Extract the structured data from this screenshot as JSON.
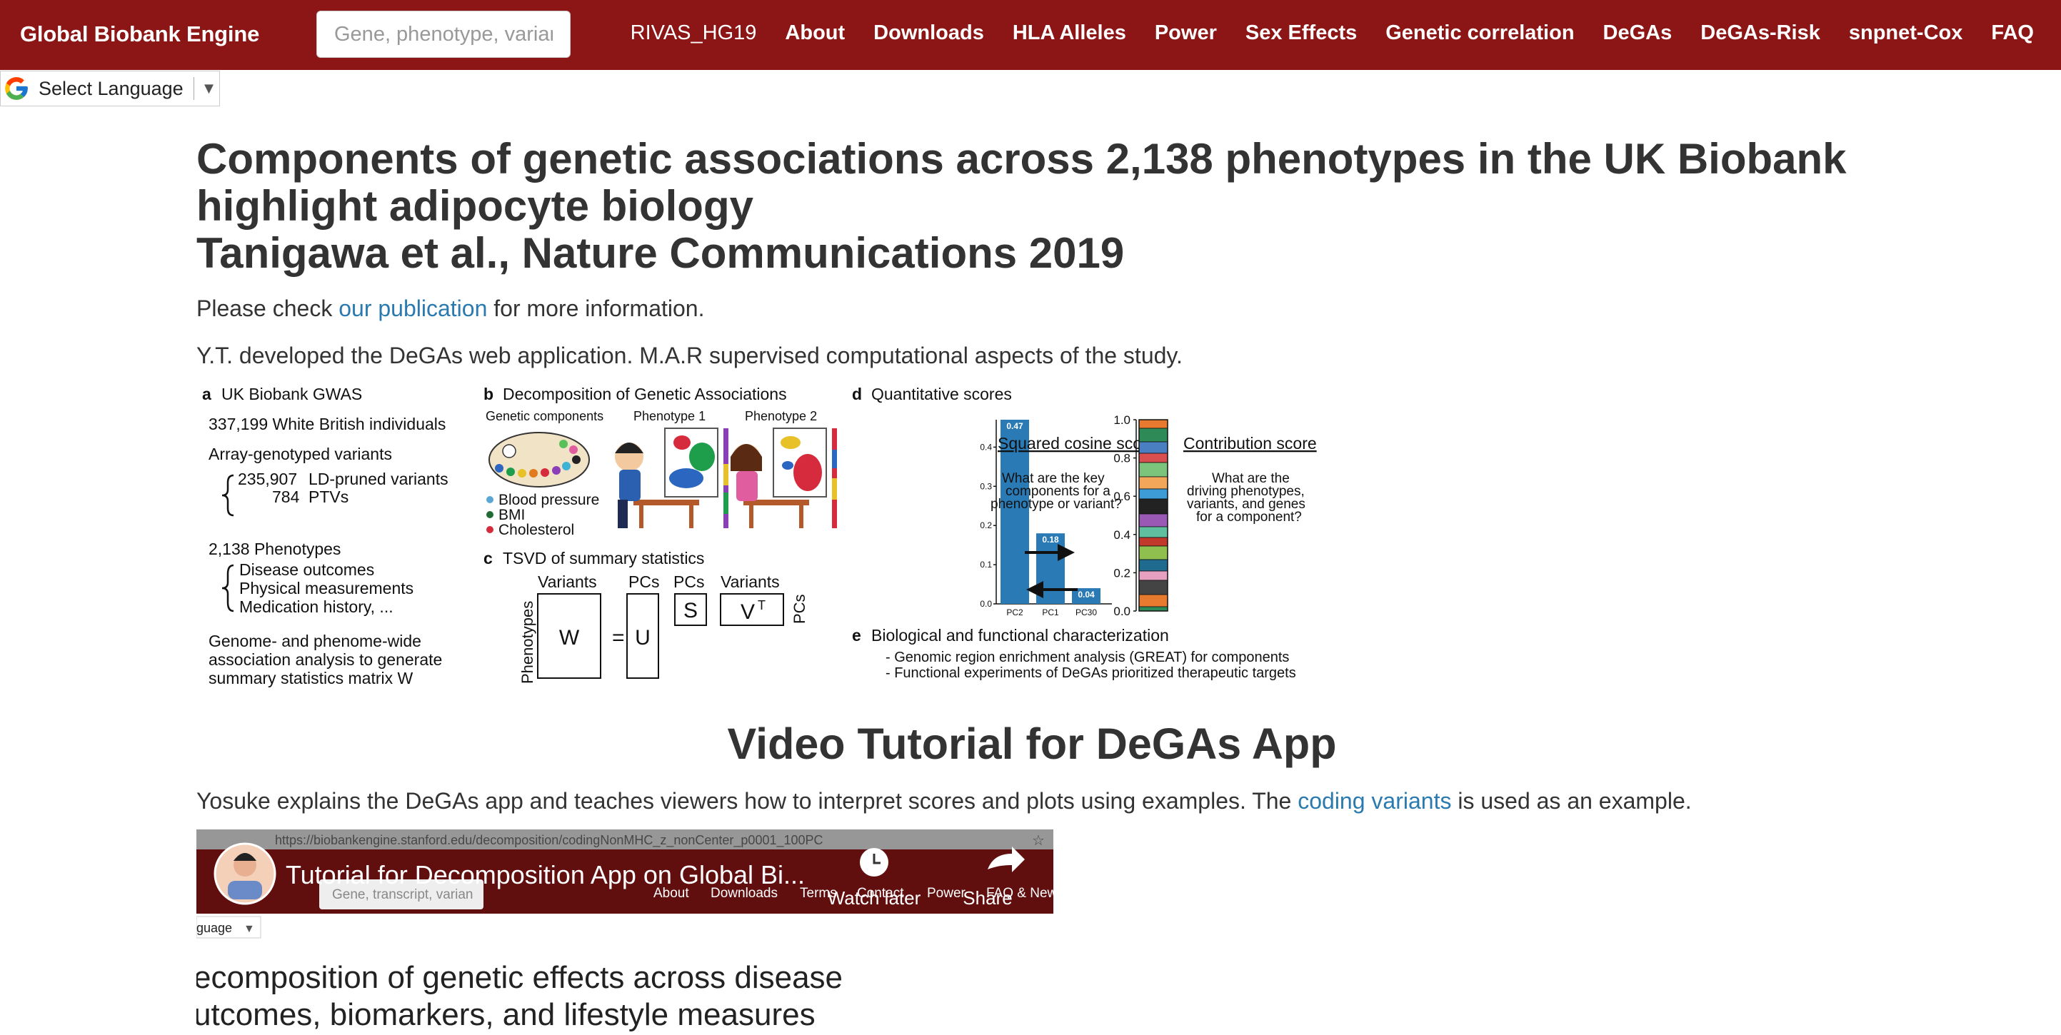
{
  "navbar": {
    "brand": "Global Biobank Engine",
    "search_placeholder": "Gene, phenotype, varian",
    "links": [
      "RIVAS_HG19",
      "About",
      "Downloads",
      "HLA Alleles",
      "Power",
      "Sex Effects",
      "Genetic correlation",
      "DeGAs",
      "DeGAs-Risk",
      "snpnet-Cox",
      "FAQ"
    ],
    "brand_color": "#8c1515"
  },
  "language": {
    "label": "Select Language",
    "icon": "google-g-icon"
  },
  "page": {
    "title_line1": "Components of genetic associations across 2,138 phenotypes in the UK Biobank",
    "title_line2": "highlight adipocyte biology",
    "title_line3": "Tanigawa et al., Nature Communications 2019",
    "check_pre": "Please check ",
    "check_link": "our publication",
    "check_post": " for more information.",
    "credits": "Y.T. developed the DeGAs web application. M.A.R supervised computational aspects of the study.",
    "video_heading": "Video Tutorial for DeGAs App",
    "video_desc_pre": "Yosuke explains the DeGAs app and teaches viewers how to interpret scores and plots using examples. The ",
    "video_desc_link": "coding variants",
    "video_desc_post": " is used as an example.",
    "link_color": "#2a7ab0"
  },
  "figure": {
    "a": {
      "letter": "a",
      "title": "UK Biobank GWAS",
      "individuals": "337,199 White British individuals",
      "array": "Array-genotyped variants",
      "ld_count": "235,907",
      "ld_label": "LD-pruned variants",
      "ptv_count": "784",
      "ptv_label": "PTVs",
      "phenotypes": "2,138 Phenotypes",
      "p1": "Disease outcomes",
      "p2": "Physical measurements",
      "p3": "Medication history, ...",
      "g1": "Genome- and phenome-wide",
      "g2": "association analysis to generate",
      "g3": "summary statistics matrix W"
    },
    "b": {
      "letter": "b",
      "title": "Decomposition of Genetic Associations",
      "sub1": "Genetic components",
      "sub2": "Phenotype 1",
      "sub3": "Phenotype 2",
      "legend": [
        "Blood pressure",
        "BMI",
        "Cholesterol"
      ]
    },
    "c": {
      "letter": "c",
      "title": "TSVD of summary statistics",
      "variants1": "Variants",
      "pcs1": "PCs",
      "pcs2": "PCs",
      "variants2": "Variants",
      "phenotypes": "Phenotypes",
      "pcs_side": "PCs",
      "w": "W",
      "eq": "=",
      "u": "U",
      "s": "S",
      "v": "V",
      "t": "T"
    },
    "d": {
      "letter": "d",
      "title": "Quantitative scores",
      "cos_title": "Squared cosine score",
      "cos_q1": "What are the key",
      "cos_q2": "components for a",
      "cos_q3": "phenotype or variant?",
      "contrib_title": "Contribution score",
      "contrib_q1": "What are the",
      "contrib_q2": "driving phenotypes,",
      "contrib_q3": "variants, and genes",
      "contrib_q4": "for a component?"
    },
    "e": {
      "letter": "e",
      "title": "Biological and functional characterization",
      "item1": "- Genomic region enrichment analysis (GREAT) for components",
      "item2": "- Functional experiments of DeGAs prioritized therapeutic targets"
    }
  },
  "chart_data": [
    {
      "type": "bar",
      "categories": [
        "PC2",
        "PC1",
        "PC30"
      ],
      "values": [
        0.47,
        0.18,
        0.04
      ],
      "data_labels": [
        "0.47",
        "0.18",
        "0.04"
      ],
      "ylim": [
        0,
        0.47
      ],
      "yticks": [
        "0.0",
        "0.1",
        "0.2",
        "0.3",
        "0.4"
      ],
      "color": "#2a7ab5"
    },
    {
      "type": "bar",
      "stacked": true,
      "yticks": [
        "0.0",
        "0.2",
        "0.4",
        "0.6",
        "0.8",
        "1.0"
      ],
      "ylim": [
        0,
        1.0
      ]
    }
  ],
  "video": {
    "title": "Tutorial for Decomposition App on Global Bi...",
    "watch_later": "Watch later",
    "share": "Share",
    "url": "https://biobankengine.stanford.edu/decomposition/codingNonMHC_z_nonCenter_p0001_100PC",
    "search_placeholder": "Gene, transcript, varian",
    "nav": [
      "About",
      "Downloads",
      "Terms",
      "Contact",
      "Power",
      "FAQ & New"
    ],
    "lang": "guage",
    "headline1": "ecomposition of genetic effects across disease",
    "headline2": "utcomes, biomarkers, and lifestyle measures"
  }
}
